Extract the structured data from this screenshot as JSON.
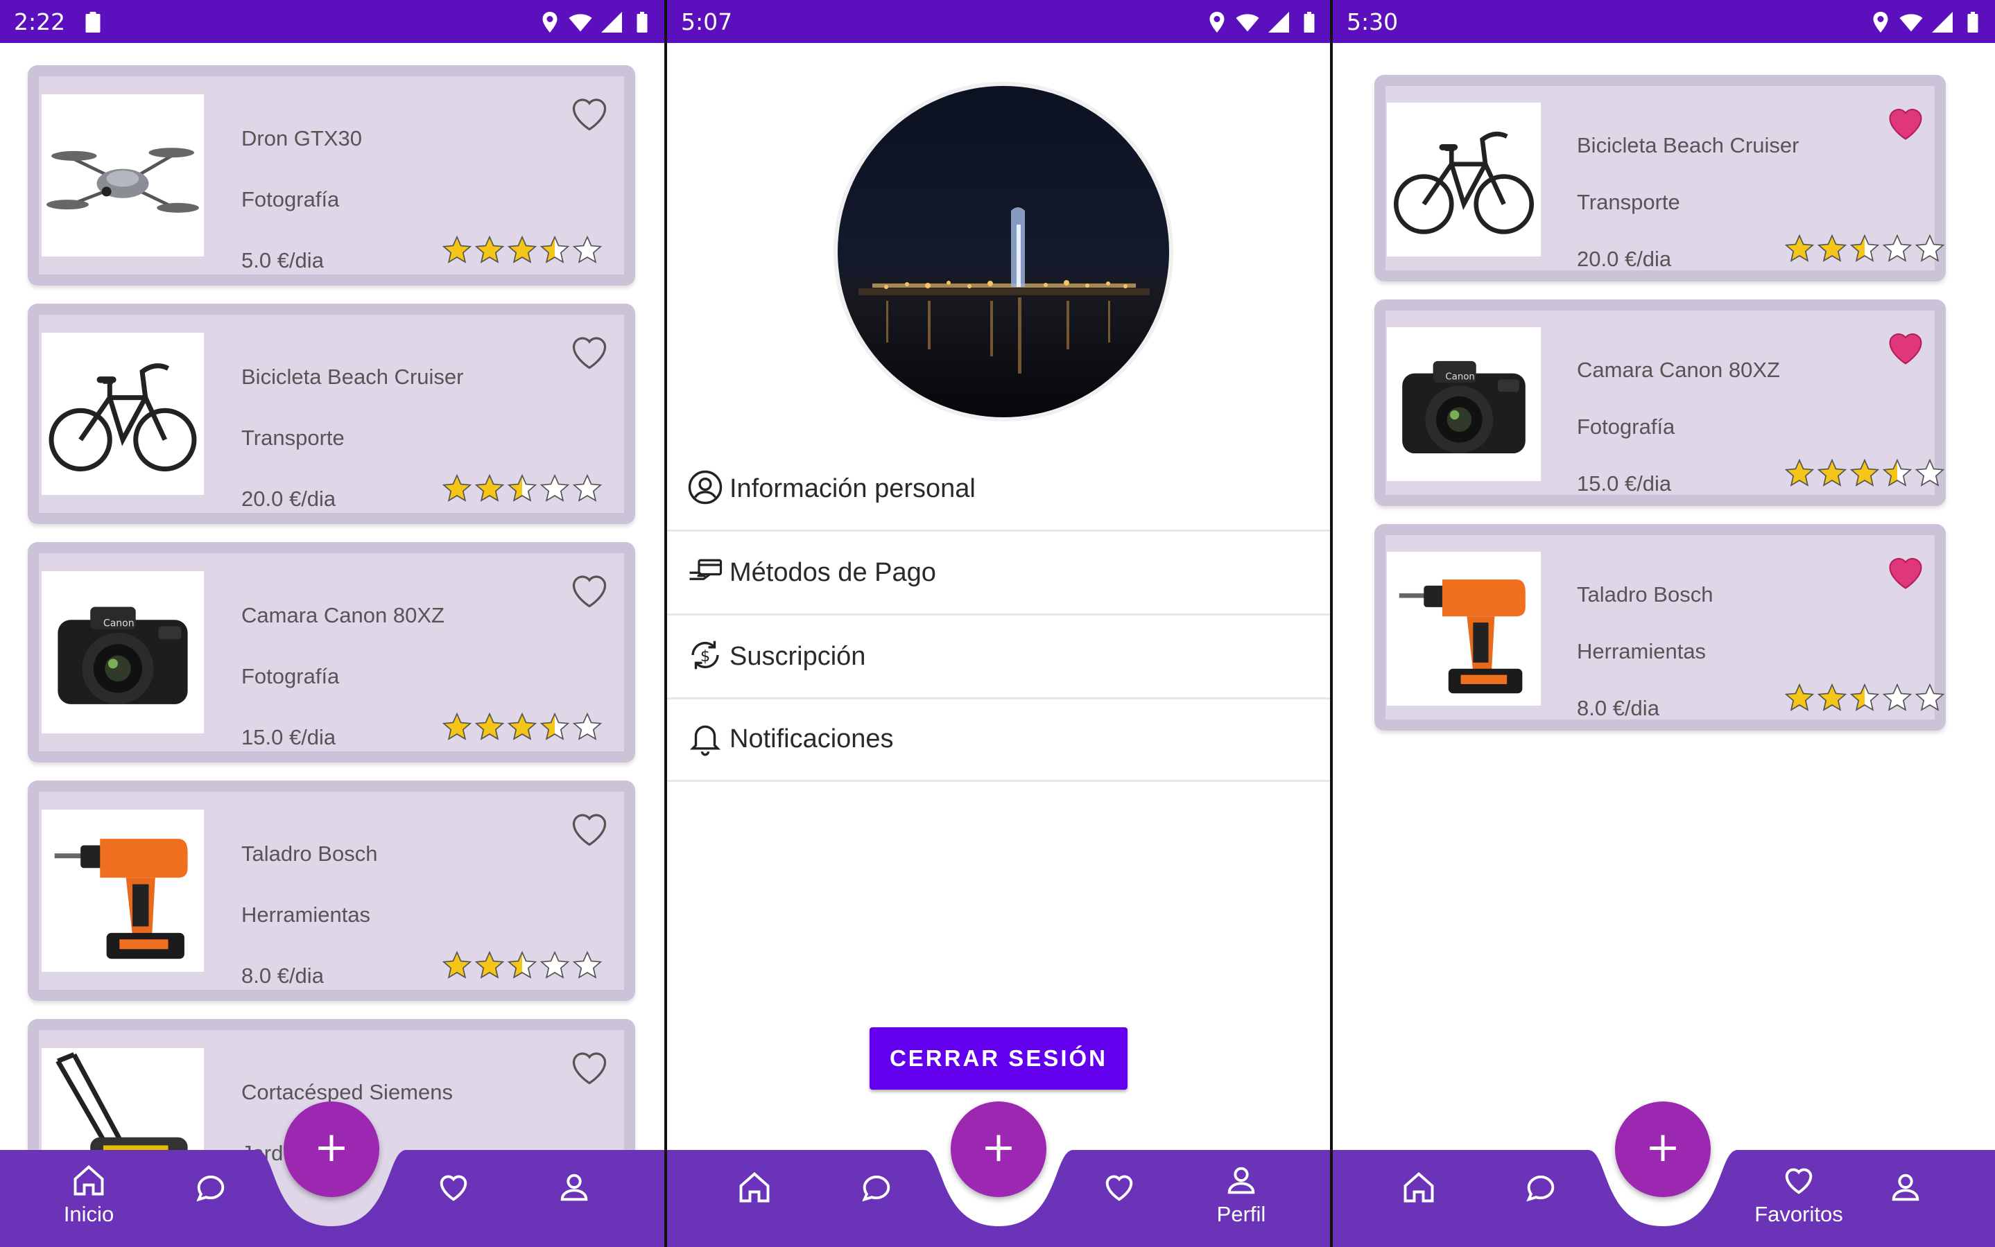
{
  "colors": {
    "status_bar": "#5b0fbd",
    "bottom_nav": "#6a33b8",
    "fab": "#9c27b0",
    "card_bg": "#dfd7e8",
    "card_border": "#ccc3d8",
    "heart_filled": "#e0367a",
    "star": "#f5c518",
    "logout_button": "#6200ee"
  },
  "screen1": {
    "status_time": "2:22",
    "products": [
      {
        "name": "Dron GTX30",
        "category": "Fotografía",
        "price": "5.0 €/dia",
        "rating": 3.5,
        "favorite": false,
        "image": "drone"
      },
      {
        "name": "Bicicleta Beach Cruiser",
        "category": "Transporte",
        "price": "20.0 €/dia",
        "rating": 2.5,
        "favorite": false,
        "image": "bicycle"
      },
      {
        "name": "Camara Canon 80XZ",
        "category": "Fotografía",
        "price": "15.0 €/dia",
        "rating": 3.5,
        "favorite": false,
        "image": "camera"
      },
      {
        "name": "Taladro Bosch",
        "category": "Herramientas",
        "price": "8.0 €/dia",
        "rating": 2.5,
        "favorite": false,
        "image": "drill"
      },
      {
        "name": "Cortacésped Siemens",
        "category": "Jardín",
        "price": "",
        "rating": 0,
        "favorite": false,
        "image": "lawnmower"
      }
    ],
    "nav": {
      "home_label": "Inicio",
      "fab": "+"
    }
  },
  "screen2": {
    "status_time": "5:07",
    "menu": [
      {
        "label": "Información personal",
        "icon": "user-circle-icon"
      },
      {
        "label": "Métodos de Pago",
        "icon": "payment-hand-icon"
      },
      {
        "label": "Suscripción",
        "icon": "dollar-cycle-icon"
      },
      {
        "label": "Notificaciones",
        "icon": "bell-icon"
      }
    ],
    "logout_label": "CERRAR SESIÓN",
    "nav": {
      "profile_label": "Perfil",
      "fab": "+"
    }
  },
  "screen3": {
    "status_time": "5:30",
    "favorites": [
      {
        "name": "Bicicleta Beach Cruiser",
        "category": "Transporte",
        "price": "20.0 €/dia",
        "rating": 2.5,
        "favorite": true,
        "image": "bicycle"
      },
      {
        "name": "Camara Canon 80XZ",
        "category": "Fotografía",
        "price": "15.0 €/dia",
        "rating": 3.5,
        "favorite": true,
        "image": "camera"
      },
      {
        "name": "Taladro Bosch",
        "category": "Herramientas",
        "price": "8.0 €/dia",
        "rating": 2.5,
        "favorite": true,
        "image": "drill"
      }
    ],
    "nav": {
      "favorites_label": "Favoritos",
      "fab": "+"
    }
  }
}
